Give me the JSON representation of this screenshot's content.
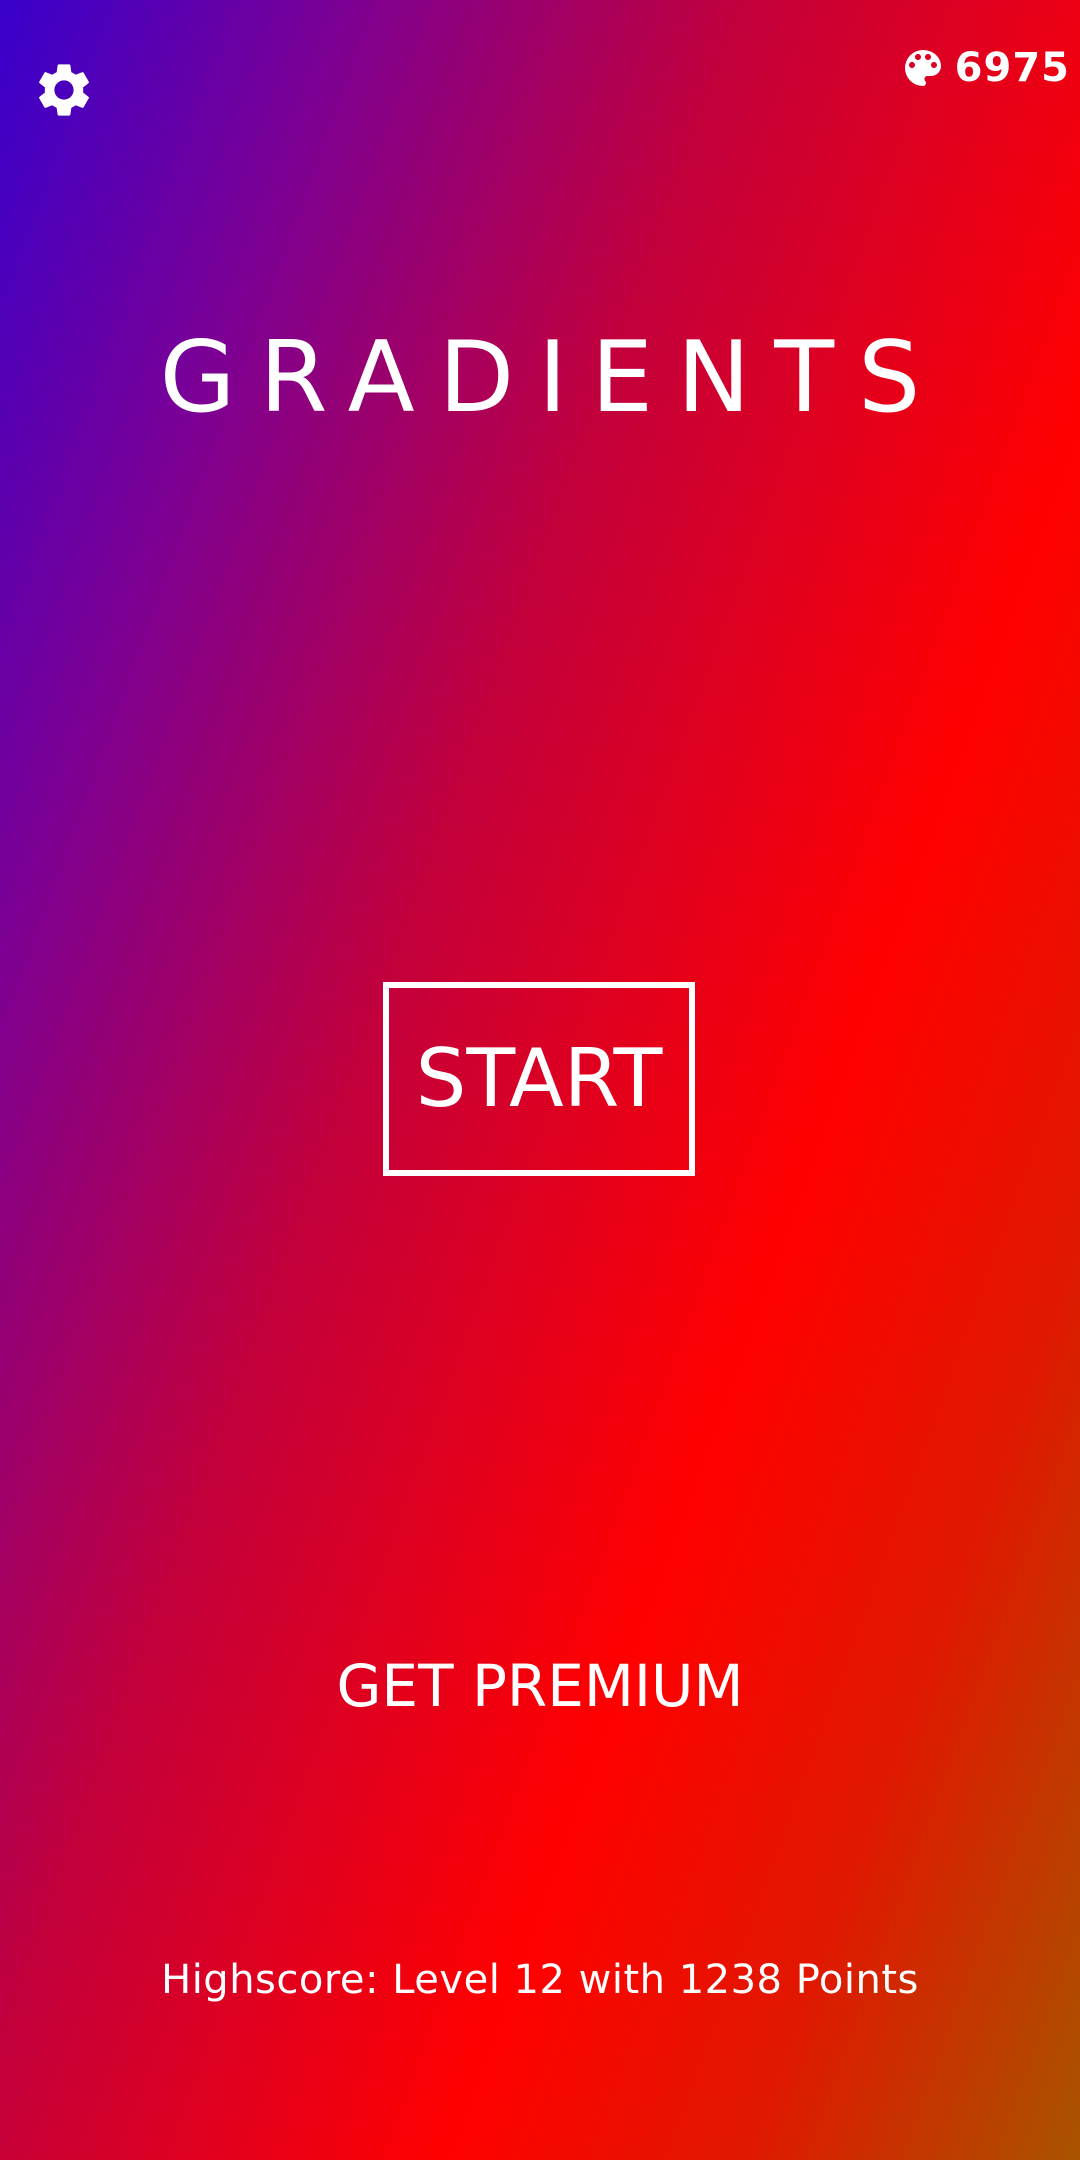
{
  "header": {
    "settings_icon": "gear-icon",
    "currency_icon": "palette-icon",
    "currency_amount": "6975"
  },
  "main": {
    "title": "GRADIENTS",
    "start_label": "START",
    "premium_label": "GET PREMIUM"
  },
  "footer": {
    "highscore_text": "Highscore: Level 12 with 1238 Points"
  },
  "colors": {
    "gradient_start": "#3800cc",
    "gradient_mid": "#ff0000",
    "gradient_end": "#a85400",
    "foreground": "#ffffff"
  }
}
